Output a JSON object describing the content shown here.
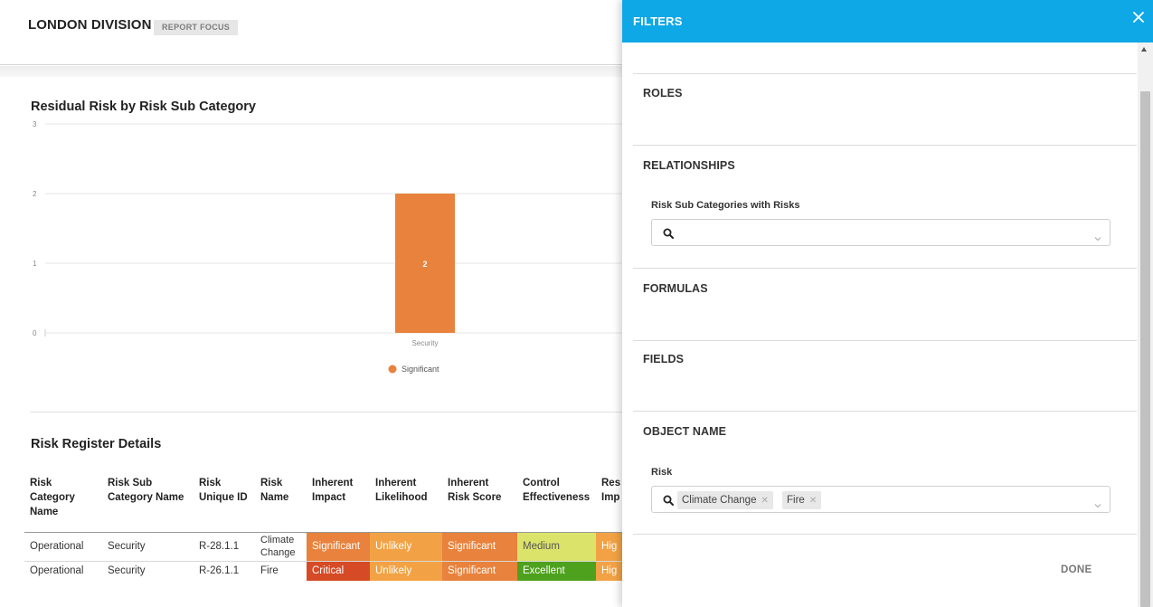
{
  "report": {
    "title": "LONDON DIVISION",
    "badge": "REPORT FOCUS"
  },
  "chart_data": {
    "type": "bar",
    "title": "Residual Risk by Risk Sub Category",
    "categories": [
      "Security"
    ],
    "series": [
      {
        "name": "Significant",
        "values": [
          2
        ],
        "color": "#e8823c"
      }
    ],
    "data_labels": [
      "2"
    ],
    "ylim": [
      0,
      3
    ],
    "yticks": [
      "0",
      "1",
      "2",
      "3"
    ],
    "grid": true,
    "legend": "bottom"
  },
  "table": {
    "title": "Risk Register Details",
    "headers": [
      [
        "Risk",
        "Category",
        "Name"
      ],
      [
        "Risk Sub",
        "Category Name"
      ],
      [
        "Risk",
        "Unique ID"
      ],
      [
        "Risk",
        "Name"
      ],
      [
        "Inherent",
        "Impact"
      ],
      [
        "Inherent",
        "Likelihood"
      ],
      [
        "Inherent",
        "Risk Score"
      ],
      [
        "Control",
        "Effectiveness"
      ],
      [
        "Res",
        "Imp"
      ]
    ],
    "rows": [
      {
        "category": "Operational",
        "sub": "Security",
        "id": "R-28.1.1",
        "name_lines": [
          "Climate",
          "Change"
        ],
        "impact": "Significant",
        "likelihood": "Unlikely",
        "score": "Significant",
        "control": "Medium",
        "residual": "Hig"
      },
      {
        "category": "Operational",
        "sub": "Security",
        "id": "R-26.1.1",
        "name_lines": [
          "Fire"
        ],
        "impact": "Critical",
        "likelihood": "Unlikely",
        "score": "Significant",
        "control": "Excellent",
        "residual": "Hig"
      }
    ],
    "colors": {
      "significant": "#e8823c",
      "unlikely": "#f2a244",
      "medium": "#dce36a",
      "high": "#f2a244",
      "critical": "#d64a26",
      "excellent": "#4ea11d"
    }
  },
  "filters": {
    "title": "FILTERS",
    "close_icon": "close-icon",
    "accent": "#0fa8e6",
    "sections": {
      "roles": "ROLES",
      "relationships": "RELATIONSHIPS",
      "formulas": "FORMULAS",
      "fields": "FIELDS",
      "object_name": "OBJECT NAME"
    },
    "relationships_label": "Risk Sub Categories with Risks",
    "risk_label": "Risk",
    "risk_chips": [
      "Climate Change",
      "Fire"
    ],
    "done": "DONE"
  }
}
